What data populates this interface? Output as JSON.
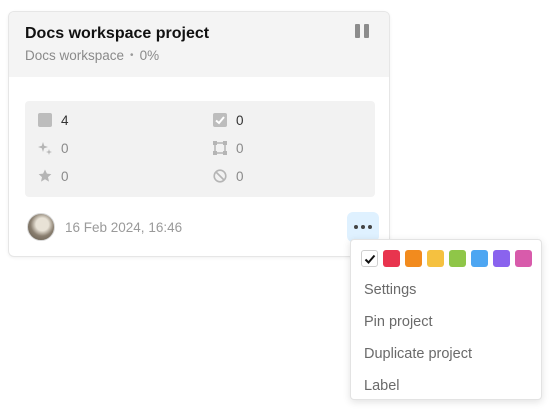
{
  "card": {
    "title": "Docs workspace project",
    "workspace": "Docs workspace",
    "separator": "•",
    "progress": "0%",
    "stats": [
      {
        "icon": "task-square-icon",
        "value": "4"
      },
      {
        "icon": "checkbox-checked-icon",
        "value": "0"
      },
      {
        "icon": "sparkle-icon",
        "value": "0"
      },
      {
        "icon": "nodes-icon",
        "value": "0"
      },
      {
        "icon": "star-icon",
        "value": "0"
      },
      {
        "icon": "blocked-icon",
        "value": "0"
      }
    ],
    "date": "16 Feb 2024, 16:46"
  },
  "menu": {
    "colors": [
      "#ffffff",
      "#e8344e",
      "#f28b1e",
      "#f5c140",
      "#8fc648",
      "#4da6f2",
      "#8a63ee",
      "#d85bab"
    ],
    "items": [
      "Settings",
      "Pin project",
      "Duplicate project",
      "Label"
    ]
  }
}
